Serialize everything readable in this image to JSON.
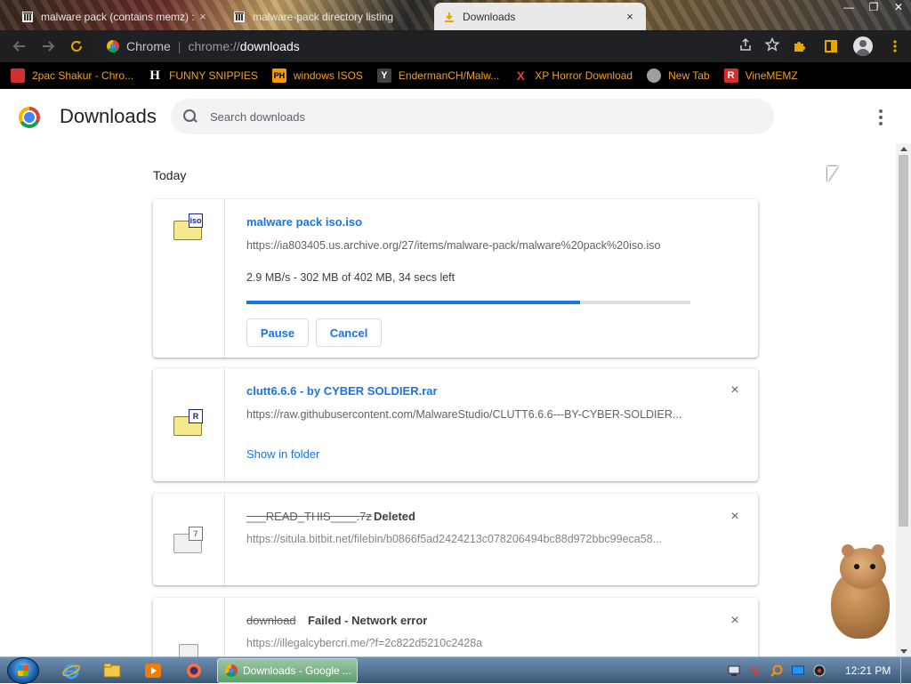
{
  "browser": {
    "tabs": [
      {
        "title": "malware pack (contains memz) :",
        "close": "×",
        "icon": "archive-org-icon"
      },
      {
        "title": "malware-pack directory listing",
        "close": "",
        "icon": "archive-org-icon"
      },
      {
        "title": "Downloads",
        "close": "×",
        "icon": "download-icon",
        "active": true
      }
    ],
    "window_controls": {
      "minimize": "—",
      "maximize": "❐",
      "close": "✕"
    },
    "omnibox": {
      "chip": "Chrome",
      "url_scheme": "chrome://",
      "url_host": "downloads"
    },
    "bookmarks": [
      {
        "label": "2pac Shakur - Chro...",
        "icon_text": "",
        "icon": "photo-icon",
        "color": "#d32f2f"
      },
      {
        "label": "FUNNY SNIPPIES",
        "icon_text": "H",
        "icon": "h-icon",
        "color": "#ffffff"
      },
      {
        "label": "windows ISOS",
        "icon_text": "PH",
        "icon": "ph-icon",
        "color": "#ff9800"
      },
      {
        "label": "EndermanCH/Malw...",
        "icon_text": "Y",
        "icon": "y-icon",
        "color": "#424242"
      },
      {
        "label": "XP Horror Download",
        "icon_text": "X",
        "icon": "x-icon",
        "color": "#e53935"
      },
      {
        "label": "New Tab",
        "icon_text": "",
        "icon": "globe-icon",
        "color": "#9e9e9e"
      },
      {
        "label": "VineMEMZ",
        "icon_text": "R",
        "icon": "r-icon",
        "color": "#d32f2f"
      }
    ]
  },
  "page": {
    "title": "Downloads",
    "search_placeholder": "Search downloads",
    "section": "Today"
  },
  "downloads": [
    {
      "name": "malware pack iso.iso",
      "url": "https://ia803405.us.archive.org/27/items/malware-pack/malware%20pack%20iso.iso",
      "progress_text": "2.9 MB/s - 302 MB of 402 MB, 34 secs left",
      "progress_fraction": 0.7512,
      "badge": "iso",
      "pause_label": "Pause",
      "cancel_label": "Cancel"
    },
    {
      "name": "clutt6.6.6 - by CYBER SOLDIER.rar",
      "url": "https://raw.githubusercontent.com/MalwareStudio/CLUTT6.6.6---BY-CYBER-SOLDIER...",
      "badge": "R",
      "link_label": "Show in folder",
      "close": "×"
    },
    {
      "name": "___READ_THIS____.7z",
      "status": "Deleted",
      "url": "https://situla.bitbit.net/filebin/b0866f5ad2424213c078206494bc88d972bbc99eca58...",
      "badge": "7",
      "close": "×"
    },
    {
      "name": "download",
      "status": "Failed - Network error",
      "url": "https://illegalcybercri.me/?f=2c822d5210c2428a",
      "close": "×"
    }
  ],
  "taskbar": {
    "task_label": "Downloads - Google ...",
    "clock": "12:21 PM",
    "pinned": [
      "internet-explorer-icon",
      "explorer-icon",
      "media-player-icon",
      "firefox-icon"
    ]
  }
}
